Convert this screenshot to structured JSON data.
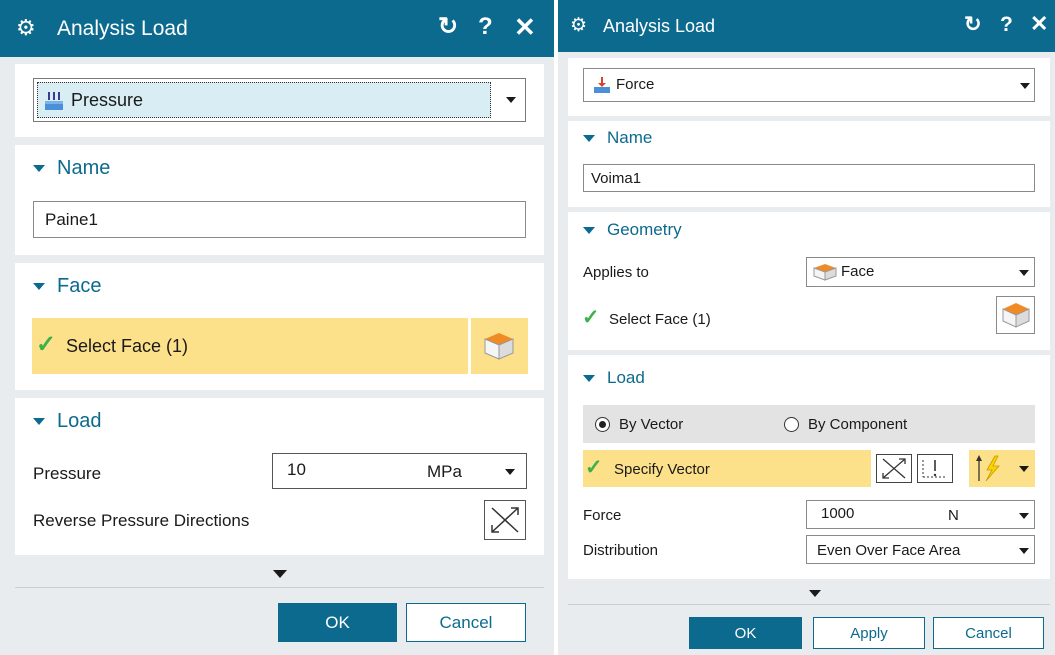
{
  "dialog_pressure": {
    "title": "Analysis Load",
    "load_type": "Pressure",
    "name_section": {
      "header": "Name",
      "value": "Paine1"
    },
    "face_section": {
      "header": "Face",
      "select_label": "Select Face (1)"
    },
    "load_section": {
      "header": "Load",
      "pressure_label": "Pressure",
      "pressure_value": "10",
      "pressure_unit": "MPa",
      "reverse_label": "Reverse Pressure Directions"
    },
    "ok_label": "OK",
    "cancel_label": "Cancel"
  },
  "dialog_force": {
    "title": "Analysis Load",
    "load_type": "Force",
    "name_section": {
      "header": "Name",
      "value": "Voima1"
    },
    "geometry_section": {
      "header": "Geometry",
      "applies_to_label": "Applies to",
      "applies_to_value": "Face",
      "select_label": "Select Face (1)"
    },
    "load_section": {
      "header": "Load",
      "radio_by_vector": "By Vector",
      "radio_by_component": "By Component",
      "selected_radio": "By Vector",
      "specify_vector_label": "Specify Vector",
      "force_label": "Force",
      "force_value": "1000",
      "force_unit": "N",
      "distribution_label": "Distribution",
      "distribution_value": "Even Over Face Area"
    },
    "ok_label": "OK",
    "apply_label": "Apply",
    "cancel_label": "Cancel"
  },
  "icons": {
    "titlebar": [
      "gear-icon",
      "reset-icon",
      "help-icon",
      "close-icon"
    ],
    "pressure_type": "pressure-icon",
    "force_type": "force-icon",
    "face_select": "face-cube-icon",
    "reverse": "reverse-direction-icon",
    "vector_tools": [
      "vector-inferred-icon",
      "vector-constructor-icon",
      "vector-flip-icon"
    ]
  },
  "colors": {
    "titlebar": "#0c6a8e",
    "dialog_bg": "#e8ecef",
    "highlight": "#fde08a",
    "accent": "#0c6a8e",
    "check": "#3cb14a",
    "face_icon": "#f08a24"
  }
}
